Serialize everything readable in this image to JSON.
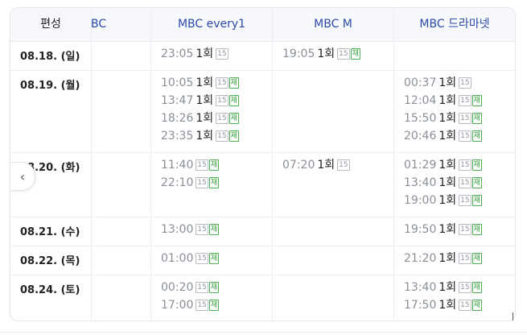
{
  "header": {
    "label": "편성",
    "channels": [
      "BC",
      "MBC every1",
      "MBC M",
      "MBC 드라마넷"
    ]
  },
  "nav": {
    "prev_icon": "‹"
  },
  "badges": {
    "age": "15",
    "rerun": "재"
  },
  "rows": [
    {
      "date": "08.18. (일)",
      "cells": [
        [],
        [
          {
            "time": "23:05",
            "ep": "1회",
            "rerun": false
          }
        ],
        [
          {
            "time": "19:05",
            "ep": "1회",
            "rerun": true
          }
        ],
        []
      ]
    },
    {
      "date": "08.19. (월)",
      "cells": [
        [],
        [
          {
            "time": "10:05",
            "ep": "1회",
            "rerun": true
          },
          {
            "time": "13:47",
            "ep": "1회",
            "rerun": true
          },
          {
            "time": "18:26",
            "ep": "1회",
            "rerun": true
          },
          {
            "time": "23:35",
            "ep": "1회",
            "rerun": true
          }
        ],
        [],
        [
          {
            "time": "00:37",
            "ep": "1회",
            "rerun": false
          },
          {
            "time": "12:04",
            "ep": "1회",
            "rerun": true
          },
          {
            "time": "15:50",
            "ep": "1회",
            "rerun": true
          },
          {
            "time": "20:46",
            "ep": "1회",
            "rerun": true
          }
        ]
      ]
    },
    {
      "date": "08.20. (화)",
      "cells": [
        [],
        [
          {
            "time": "11:40",
            "ep": "",
            "rerun": true
          },
          {
            "time": "22:10",
            "ep": "",
            "rerun": true
          }
        ],
        [
          {
            "time": "07:20",
            "ep": "1회",
            "rerun": false
          }
        ],
        [
          {
            "time": "01:29",
            "ep": "1회",
            "rerun": true
          },
          {
            "time": "13:40",
            "ep": "1회",
            "rerun": true
          },
          {
            "time": "19:00",
            "ep": "1회",
            "rerun": true
          }
        ]
      ]
    },
    {
      "date": "08.21. (수)",
      "cells": [
        [],
        [
          {
            "time": "13:00",
            "ep": "",
            "rerun": true
          }
        ],
        [],
        [
          {
            "time": "19:50",
            "ep": "1회",
            "rerun": true
          }
        ]
      ]
    },
    {
      "date": "08.22. (목)",
      "cells": [
        [],
        [
          {
            "time": "01:00",
            "ep": "",
            "rerun": true
          }
        ],
        [],
        [
          {
            "time": "21:20",
            "ep": "1회",
            "rerun": true
          }
        ]
      ]
    },
    {
      "date": "08.24. (토)",
      "cells": [
        [],
        [
          {
            "time": "00:20",
            "ep": "",
            "rerun": true
          },
          {
            "time": "17:00",
            "ep": "",
            "rerun": true
          }
        ],
        [],
        [
          {
            "time": "13:40",
            "ep": "1회",
            "rerun": true
          },
          {
            "time": "17:50",
            "ep": "1회",
            "rerun": true
          }
        ]
      ]
    }
  ]
}
